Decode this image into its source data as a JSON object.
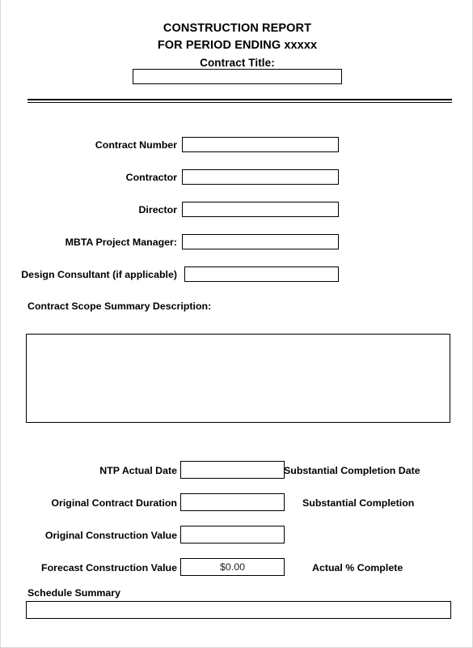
{
  "document": {
    "header": {
      "line1": "CONSTRUCTION REPORT",
      "line2": "FOR PERIOD ENDING xxxxx",
      "line3": "Contract Title:",
      "title_value": "",
      "title_placeholder": ""
    },
    "fields": [
      {
        "label": "Contract Number",
        "value": ""
      },
      {
        "label": "Contractor",
        "value": ""
      },
      {
        "label": "Director",
        "value": ""
      },
      {
        "label": "MBTA Project Manager:",
        "value": ""
      },
      {
        "label": "Design Consultant (if applicable)",
        "value": ""
      }
    ],
    "scope": {
      "label": "Contract Scope Summary Description:",
      "value": ""
    },
    "summary_rows": [
      {
        "label": "NTP Actual Date",
        "value": "",
        "right_label": "Substantial Completion Date"
      },
      {
        "label": "Original Contract Duration",
        "value": "",
        "right_label": "Substantial Completion"
      },
      {
        "label": "Original Construction Value",
        "value": "",
        "right_label": ""
      },
      {
        "label": "Forecast Construction Value",
        "value": "$0.00",
        "right_label": "Actual % Complete"
      }
    ],
    "schedule": {
      "label": "Schedule Summary",
      "value": ""
    },
    "colors": {
      "ink": "#000000",
      "paper": "#ffffff",
      "value_text": "#222222",
      "page_border": "#d8d8d8"
    }
  }
}
